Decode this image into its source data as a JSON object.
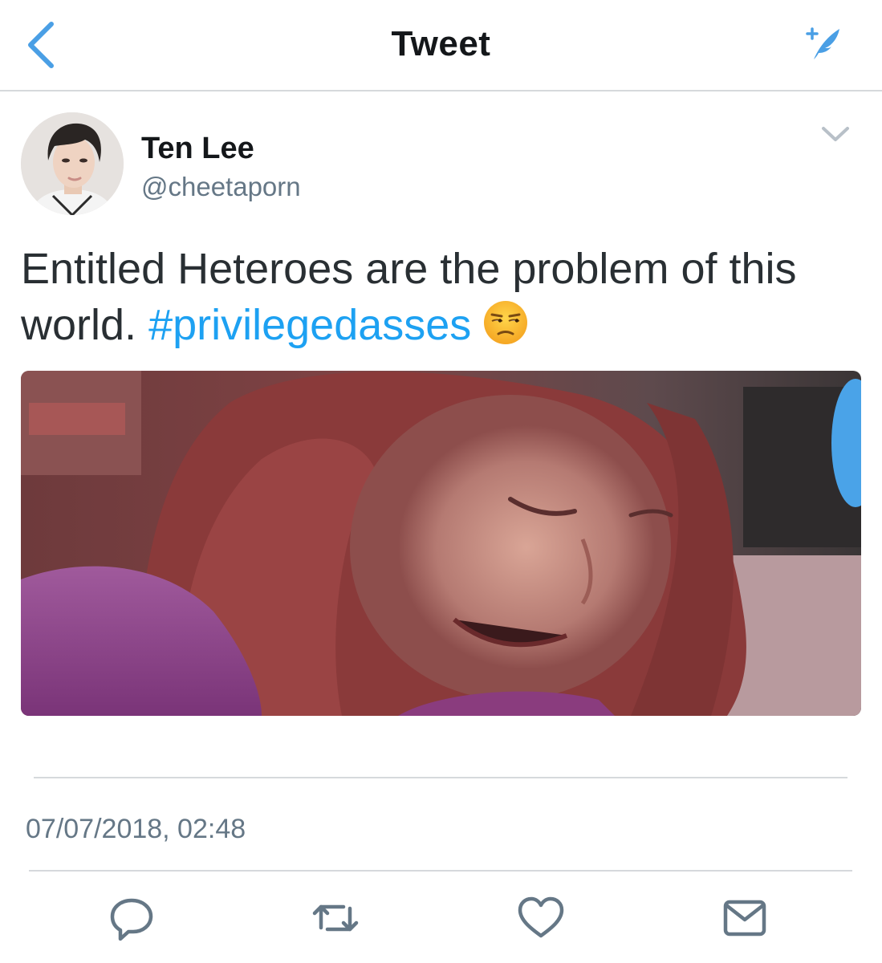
{
  "navbar": {
    "title": "Tweet",
    "back_icon": "chevron-left-icon",
    "compose_icon": "compose-feather-icon",
    "accent_color": "#4a9fe5"
  },
  "tweet": {
    "author": {
      "display_name": "Ten Lee",
      "handle": "@cheetaporn"
    },
    "text": "Entitled Heteroes are the problem of this world.",
    "hashtag": "#privilegedasses",
    "emoji": "unamused-face",
    "media": "photo",
    "timestamp": "07/07/2018, 02:48",
    "hashtag_color": "#1da1f2"
  },
  "actions": [
    {
      "icon": "reply-icon"
    },
    {
      "icon": "retweet-icon"
    },
    {
      "icon": "like-heart-icon"
    },
    {
      "icon": "direct-message-envelope-icon"
    }
  ]
}
